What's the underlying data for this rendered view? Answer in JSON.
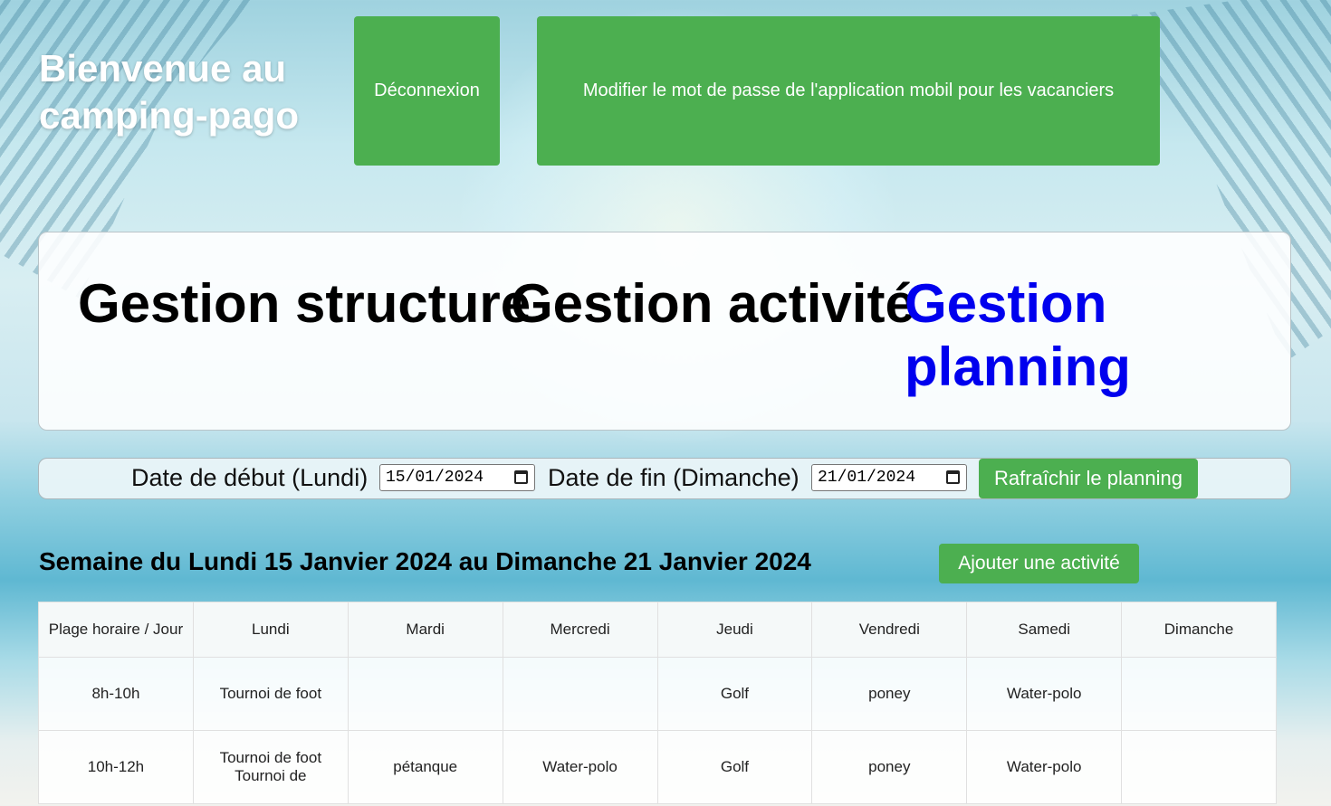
{
  "header": {
    "title": "Bienvenue au camping-pago",
    "logout_label": "Déconnexion",
    "change_password_label": "Modifier le mot de passe de l'application mobil pour les vacanciers",
    "button_color": "#4caf50"
  },
  "nav": {
    "structure": "Gestion structure",
    "activite": "Gestion activité",
    "planning": "Gestion planning",
    "active_color": "#0000ee"
  },
  "filters": {
    "start_label": "Date de début (Lundi)",
    "start_value": "15/01/2024",
    "end_label": "Date de fin (Dimanche)",
    "end_value": "21/01/2024",
    "refresh_label": "Rafraîchir le planning"
  },
  "week": {
    "title": "Semaine du Lundi 15 Janvier 2024 au Dimanche 21 Janvier 2024",
    "add_label": "Ajouter une activité"
  },
  "planning": {
    "headers": [
      "Plage horaire / Jour",
      "Lundi",
      "Mardi",
      "Mercredi",
      "Jeudi",
      "Vendredi",
      "Samedi",
      "Dimanche"
    ],
    "rows": [
      {
        "slot": "8h-10h",
        "cells": [
          "Tournoi de foot",
          "",
          "",
          "Golf",
          "poney",
          "Water-polo",
          ""
        ]
      },
      {
        "slot": "10h-12h",
        "cells": [
          "Tournoi de foot Tournoi de",
          "pétanque",
          "Water-polo",
          "Golf",
          "poney",
          "Water-polo",
          ""
        ]
      }
    ]
  }
}
